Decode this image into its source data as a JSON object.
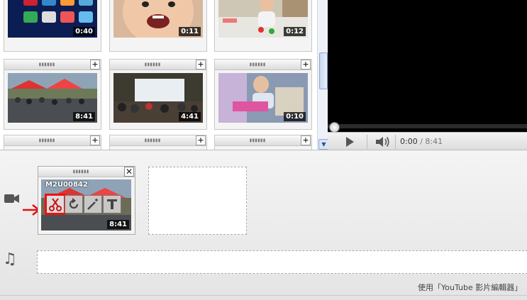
{
  "clips": [
    {
      "duration": "0:40"
    },
    {
      "duration": "0:11"
    },
    {
      "duration": "0:12"
    },
    {
      "duration": "8:41"
    },
    {
      "duration": "4:41"
    },
    {
      "duration": "0:10"
    }
  ],
  "player": {
    "time_current": "0:00",
    "time_separator": " / ",
    "time_total": "8:41"
  },
  "timeline": {
    "clip_title": "M2U00842",
    "clip_duration": "8:41",
    "footer": "使用「YouTube 影片編輯器」"
  },
  "icons": {
    "add": "+",
    "close": "✕",
    "grip": "▮▮▮▮▮▮",
    "music": "♫",
    "scroll_down": "▼"
  },
  "colors": {
    "highlight": "#e11111",
    "player_bg": "#000000",
    "timeline_bg": "#eeeeee"
  }
}
